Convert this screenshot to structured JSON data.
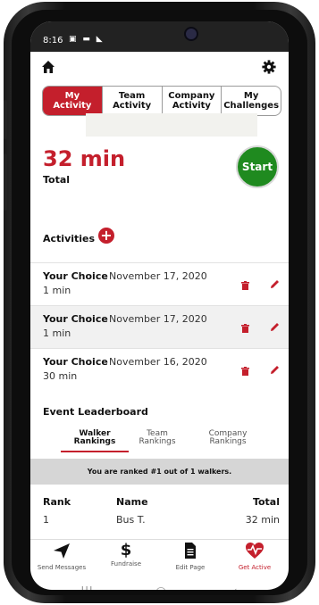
{
  "status_bar": {
    "time": "8:16",
    "icons": "▣ ▬ ◣"
  },
  "tabs": [
    {
      "label": "My\nActivity",
      "active": true
    },
    {
      "label": "Team\nActivity",
      "active": false
    },
    {
      "label": "Company\nActivity",
      "active": false
    },
    {
      "label": "My\nChallenges",
      "active": false
    }
  ],
  "summary": {
    "total_value": "32 min",
    "total_label": "Total",
    "start_label": "Start"
  },
  "activities": {
    "title": "Activities",
    "items": [
      {
        "name": "Your Choice",
        "date": "November 17, 2020",
        "duration": "1 min"
      },
      {
        "name": "Your Choice",
        "date": "November 17, 2020",
        "duration": "1 min"
      },
      {
        "name": "Your Choice",
        "date": "November 16, 2020",
        "duration": "30 min"
      }
    ]
  },
  "leaderboard": {
    "title": "Event Leaderboard",
    "tabs": [
      "Walker\nRankings",
      "Team\nRankings",
      "Company\nRankings"
    ],
    "rank_message": "You are ranked #1 out of 1 walkers.",
    "columns": {
      "rank": "Rank",
      "name": "Name",
      "total": "Total"
    },
    "rows": [
      {
        "rank": "1",
        "name": "Bus T.",
        "total": "32 min"
      }
    ]
  },
  "bottom_nav": [
    {
      "label": "Send Messages",
      "icon": "send-icon"
    },
    {
      "label": "Fundraise",
      "icon": "dollar-icon"
    },
    {
      "label": "Edit Page",
      "icon": "document-icon"
    },
    {
      "label": "Get Active",
      "icon": "heart-pulse-icon"
    }
  ],
  "colors": {
    "accent": "#c41f2c",
    "start_green": "#1f8a1f"
  }
}
